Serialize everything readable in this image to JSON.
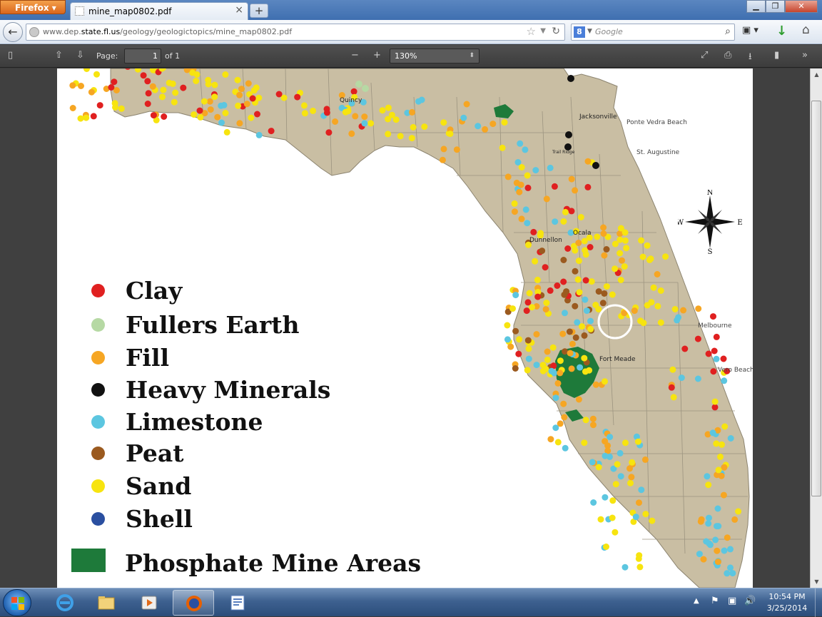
{
  "browser": {
    "menu_label": "Firefox",
    "tab_title": "mine_map0802.pdf",
    "url_prefix": "www.dep.",
    "url_domain": "state.fl.us",
    "url_path": "/geology/geologictopics/mine_map0802.pdf",
    "search_placeholder": "Google",
    "search_engine_icon": "g-icon"
  },
  "pdf_toolbar": {
    "page_label": "Page:",
    "page_value": "1",
    "page_total": "of 1",
    "zoom": "130%"
  },
  "map": {
    "cities": {
      "quincy": "Quincy",
      "jacksonville": "Jacksonville",
      "ponte_vedra": "Ponte Vedra Beach",
      "st_augustine": "St. Augustine",
      "trail_ridge": "Trail Ridge",
      "ocala": "Ocala",
      "dunnellon": "Dunnellon",
      "melbourne": "Melbourne",
      "fort_meade": "Fort Meade",
      "vero_beach": "Vero Beach"
    },
    "compass": {
      "n": "N",
      "s": "S",
      "e": "E",
      "w": "W"
    },
    "legend": [
      {
        "label": "Clay",
        "color": "#e02020"
      },
      {
        "label": "Fullers Earth",
        "color": "#b6d9a4"
      },
      {
        "label": "Fill",
        "color": "#f6a623"
      },
      {
        "label": "Heavy Minerals",
        "color": "#111111"
      },
      {
        "label": "Limestone",
        "color": "#5cc6e0"
      },
      {
        "label": "Peat",
        "color": "#9b5a1f"
      },
      {
        "label": "Sand",
        "color": "#f7e40f"
      },
      {
        "label": "Shell",
        "color": "#2a4fa0"
      }
    ],
    "phosphate_label": "Phosphate Mine Areas",
    "phosphate_color": "#1e7a3a",
    "land_color": "#c9bea3"
  },
  "taskbar": {
    "time": "10:54 PM",
    "date": "3/25/2014"
  }
}
